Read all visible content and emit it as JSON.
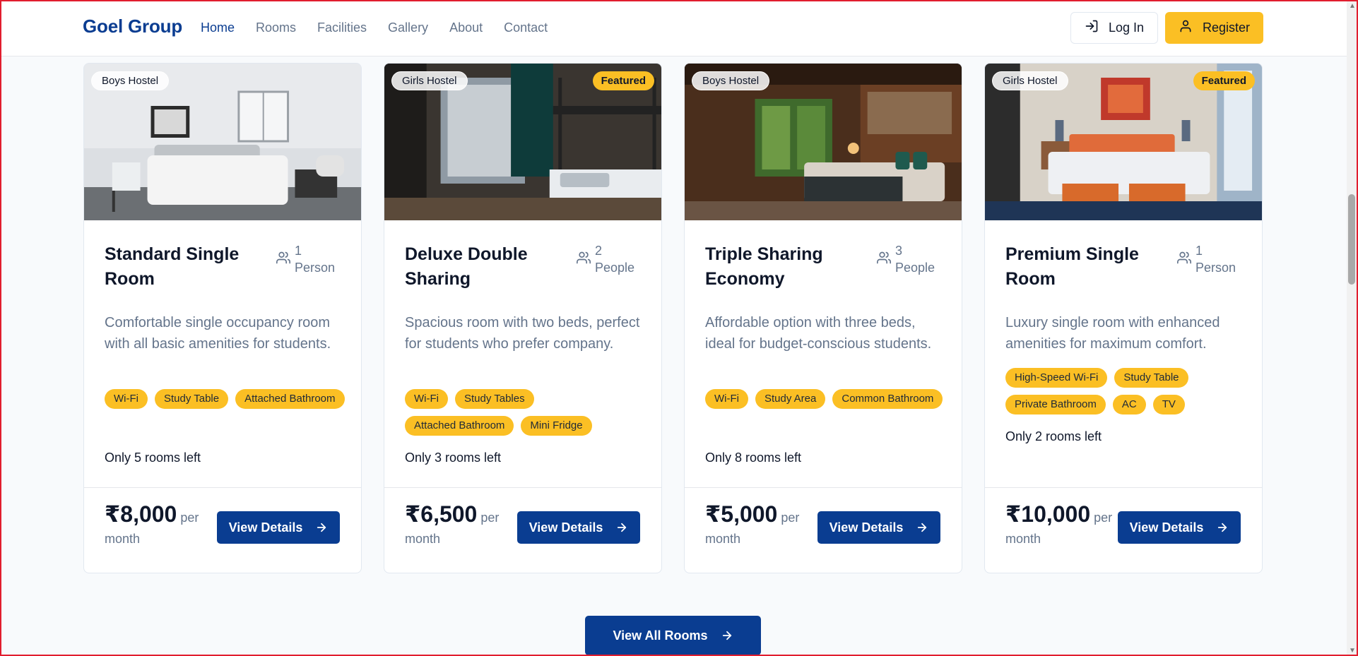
{
  "header": {
    "brand": "Goel Group",
    "nav": [
      "Home",
      "Rooms",
      "Facilities",
      "Gallery",
      "About",
      "Contact"
    ],
    "login_label": "Log In",
    "register_label": "Register"
  },
  "cards": [
    {
      "hostel": "Boys Hostel",
      "featured": "",
      "title": "Standard Single Room",
      "occ_num": "1",
      "occ_unit": "Person",
      "description": "Comfortable single occupancy room with all basic amenities for students.",
      "amenities": [
        "Wi-Fi",
        "Study Table",
        "Attached Bathroom"
      ],
      "availability": "Only 5 rooms left",
      "price": "₹8,000",
      "price_suffix": "per month",
      "button": "View Details"
    },
    {
      "hostel": "Girls Hostel",
      "featured": "Featured",
      "title": "Deluxe Double Sharing",
      "occ_num": "2",
      "occ_unit": "People",
      "description": "Spacious room with two beds, perfect for students who prefer company.",
      "amenities": [
        "Wi-Fi",
        "Study Tables",
        "Attached Bathroom",
        "Mini Fridge"
      ],
      "availability": "Only 3 rooms left",
      "price": "₹6,500",
      "price_suffix": "per month",
      "button": "View Details"
    },
    {
      "hostel": "Boys Hostel",
      "featured": "",
      "title": "Triple Sharing Economy",
      "occ_num": "3",
      "occ_unit": "People",
      "description": "Affordable option with three beds, ideal for budget-conscious students.",
      "amenities": [
        "Wi-Fi",
        "Study Area",
        "Common Bathroom"
      ],
      "availability": "Only 8 rooms left",
      "price": "₹5,000",
      "price_suffix": "per month",
      "button": "View Details"
    },
    {
      "hostel": "Girls Hostel",
      "featured": "Featured",
      "title": "Premium Single Room",
      "occ_num": "1",
      "occ_unit": "Person",
      "description": "Luxury single room with enhanced amenities for maximum comfort.",
      "amenities": [
        "High-Speed Wi-Fi",
        "Study Table",
        "Private Bathroom",
        "AC",
        "TV"
      ],
      "availability": "Only 2 rooms left",
      "price": "₹10,000",
      "price_suffix": "per month",
      "button": "View Details"
    }
  ],
  "view_all_label": "View All Rooms",
  "colors": {
    "brand": "#0b3d91",
    "accent": "#fbbf24",
    "button": "#0a3d91",
    "muted": "#64748b"
  },
  "icons": {
    "login": "log-in-icon",
    "register": "user-icon",
    "occupancy": "users-icon",
    "arrow": "arrow-right-icon"
  }
}
